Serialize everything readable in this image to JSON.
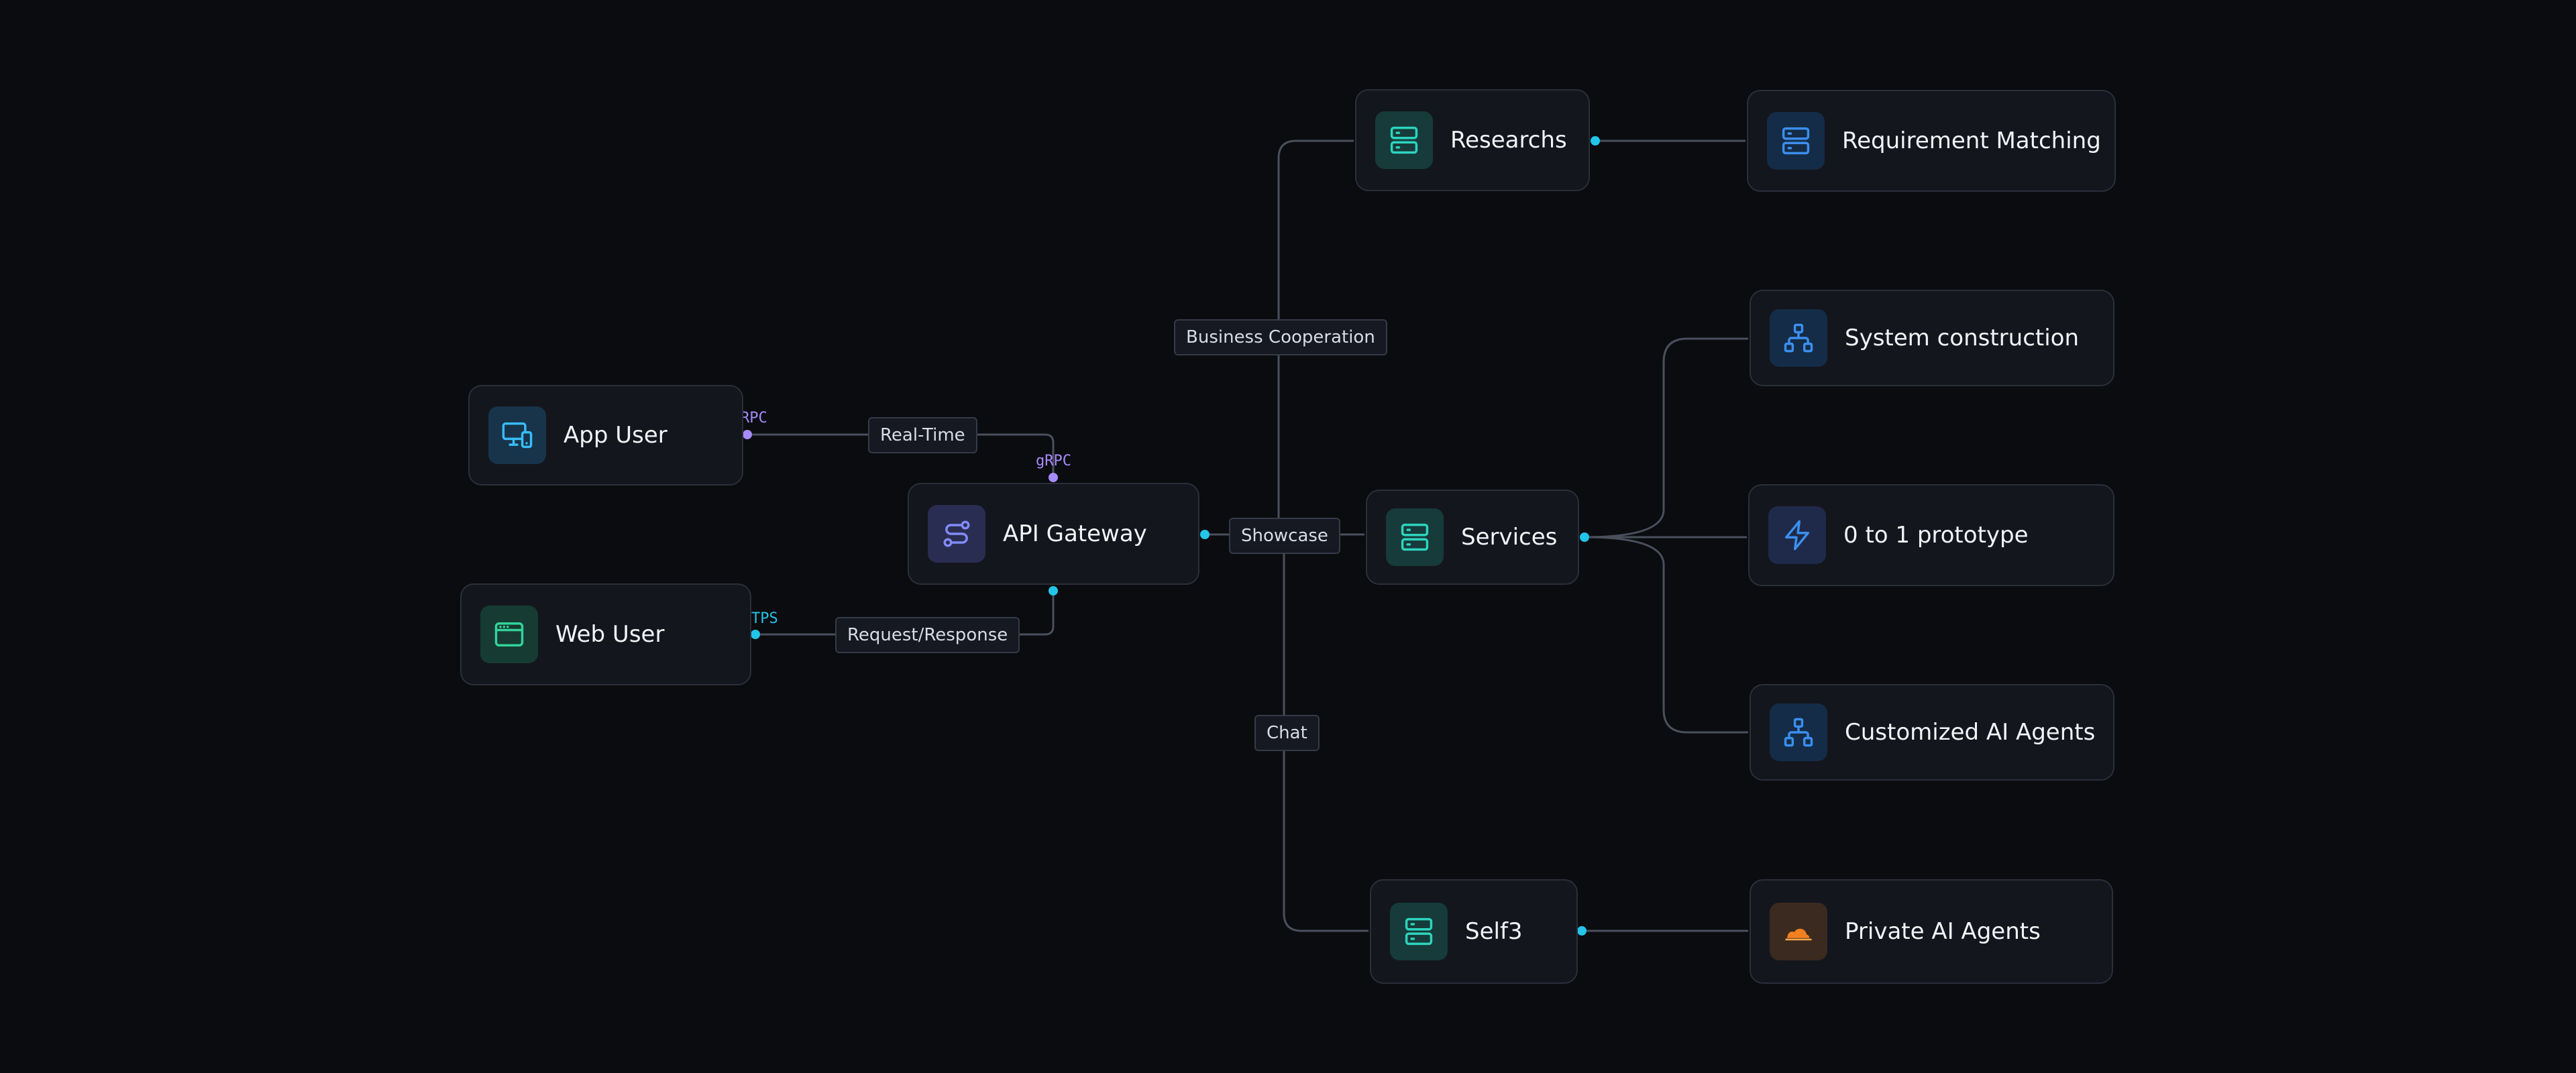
{
  "colors": {
    "background": "#0b0c10",
    "node_bg": "#14161d",
    "node_border": "#2b2f3a",
    "edge": "#4a4f5c",
    "cyan_port": "#22c5e8",
    "purple_port": "#a78bfa"
  },
  "nodes": {
    "app_user": {
      "label": "App User",
      "icon": "devices-icon"
    },
    "web_user": {
      "label": "Web User",
      "icon": "browser-window-icon"
    },
    "api_gateway": {
      "label": "API Gateway",
      "icon": "route-icon"
    },
    "researchs": {
      "label": "Researchs",
      "icon": "server-icon"
    },
    "services": {
      "label": "Services",
      "icon": "server-icon"
    },
    "self3": {
      "label": "Self3",
      "icon": "server-icon"
    },
    "requirement_matching": {
      "label": "Requirement Matching",
      "icon": "server-icon"
    },
    "system_construction": {
      "label": "System construction",
      "icon": "network-icon"
    },
    "prototype": {
      "label": "0 to 1 prototype",
      "icon": "lightning-icon"
    },
    "customized_agents": {
      "label": "Customized AI Agents",
      "icon": "network-icon"
    },
    "private_agents": {
      "label": "Private AI Agents",
      "icon": "cloud-icon"
    }
  },
  "edges": {
    "real_time": "Real-Time",
    "request_response": "Request/Response",
    "business_cooperation": "Business Cooperation",
    "showcase": "Showcase",
    "chat": "Chat"
  },
  "ports": {
    "app_user_out": "RPC",
    "gateway_in": "gRPC",
    "web_user_out": "TPS"
  }
}
